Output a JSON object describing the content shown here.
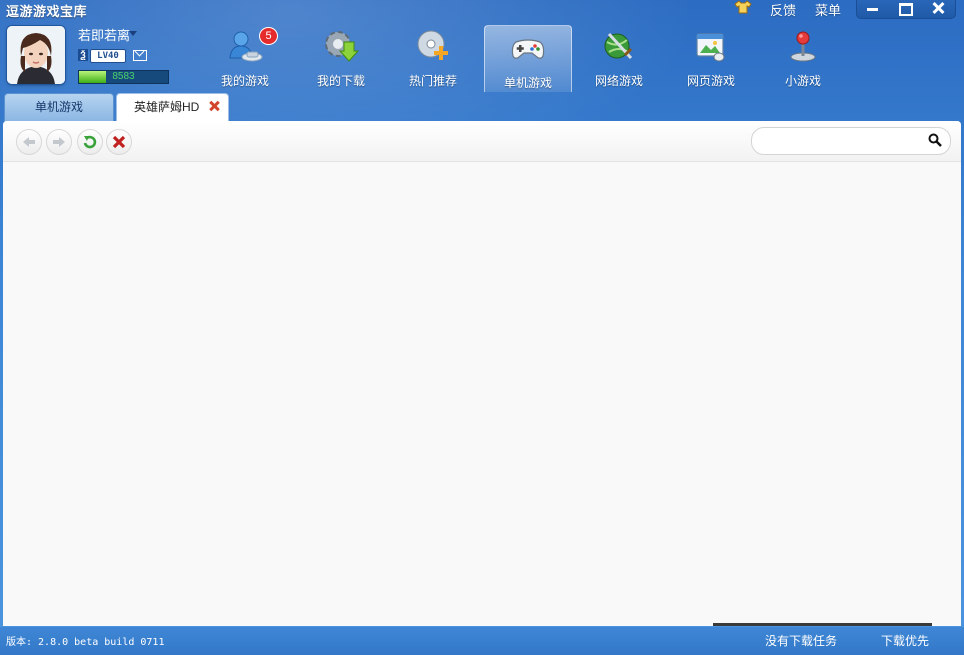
{
  "app": {
    "title": "逗游游戏宝库"
  },
  "topbar": {
    "feedback": "反馈",
    "menu": "菜单"
  },
  "user": {
    "name": "若即若离",
    "level": "LV40",
    "experience": "8583",
    "experience_fill": 0.3
  },
  "nav": [
    {
      "label": "我的游戏",
      "icon": "user-group-icon",
      "badge": "5"
    },
    {
      "label": "我的下载",
      "icon": "gear-download-icon"
    },
    {
      "label": "热门推荐",
      "icon": "disc-plus-icon"
    },
    {
      "label": "单机游戏",
      "icon": "gamepad-icon",
      "active": true
    },
    {
      "label": "网络游戏",
      "icon": "globe-sword-icon"
    },
    {
      "label": "网页游戏",
      "icon": "browser-window-icon"
    },
    {
      "label": "小游戏",
      "icon": "joystick-icon"
    }
  ],
  "tabs": [
    {
      "label": "单机游戏"
    },
    {
      "label": "英雄萨姆HD",
      "closable": true
    }
  ],
  "search": {
    "value": "",
    "placeholder": ""
  },
  "statusbar": {
    "version": "版本: 2.8.0 beta build 0711",
    "no_tasks": "没有下载任务",
    "priority": "下载优先"
  },
  "colors": {
    "accent": "#3d86d6",
    "active_nav": "#7db3ea",
    "close_red": "#d2452a"
  }
}
